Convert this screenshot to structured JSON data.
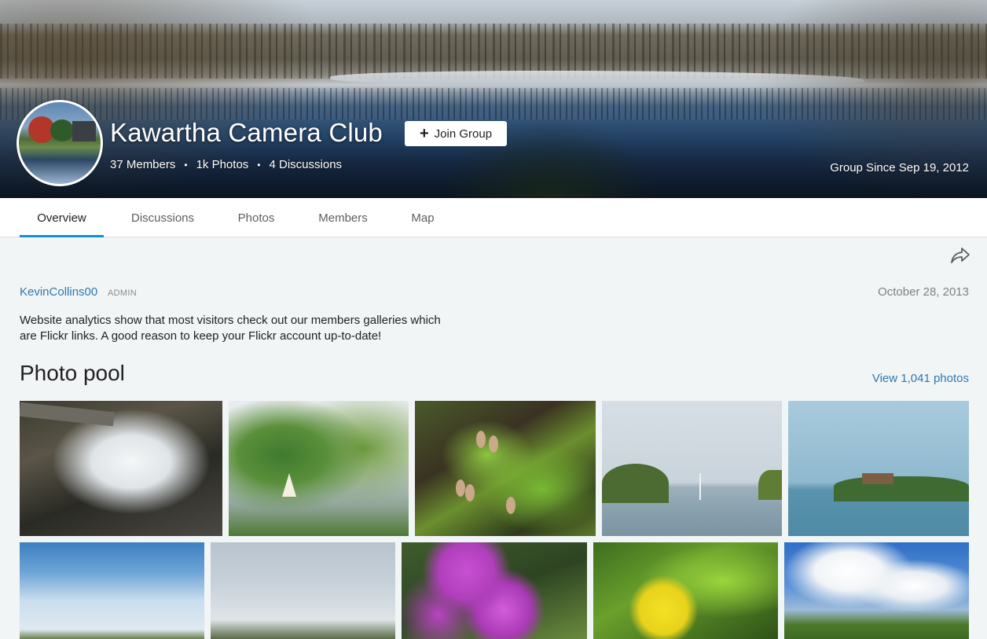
{
  "header": {
    "group_name": "Kawartha Camera Club",
    "join_label": "Join Group",
    "join_icon": "plus-icon",
    "stats": {
      "members": "37 Members",
      "photos": "1k Photos",
      "discussions": "4 Discussions",
      "separator": "•"
    },
    "group_since": "Group Since Sep 19, 2012"
  },
  "tabs": [
    {
      "label": "Overview",
      "active": true
    },
    {
      "label": "Discussions",
      "active": false
    },
    {
      "label": "Photos",
      "active": false
    },
    {
      "label": "Members",
      "active": false
    },
    {
      "label": "Map",
      "active": false
    }
  ],
  "post": {
    "author": "KevinCollins00",
    "role": "ADMIN",
    "date": "October 28, 2013",
    "body": "Website analytics show that most visitors check out our members galleries which are Flickr links. A good reason to keep your Flickr account up-to-date!",
    "share_icon": "share-arrow-icon"
  },
  "photo_pool": {
    "title": "Photo pool",
    "view_link": "View 1,041 photos",
    "photos": [
      {
        "subject": "waterfall"
      },
      {
        "subject": "sailboat-shoreline"
      },
      {
        "subject": "branches-seed-pods"
      },
      {
        "subject": "lake-sailboat"
      },
      {
        "subject": "island-lake"
      },
      {
        "subject": "sky-clouds"
      },
      {
        "subject": "overcast-lake"
      },
      {
        "subject": "purple-rhododendron"
      },
      {
        "subject": "yellow-flower"
      },
      {
        "subject": "clouds-trees"
      }
    ]
  },
  "colors": {
    "accent_blue": "#128fdc",
    "link_blue": "#2d78b0",
    "page_background": "#f2f5f6"
  }
}
